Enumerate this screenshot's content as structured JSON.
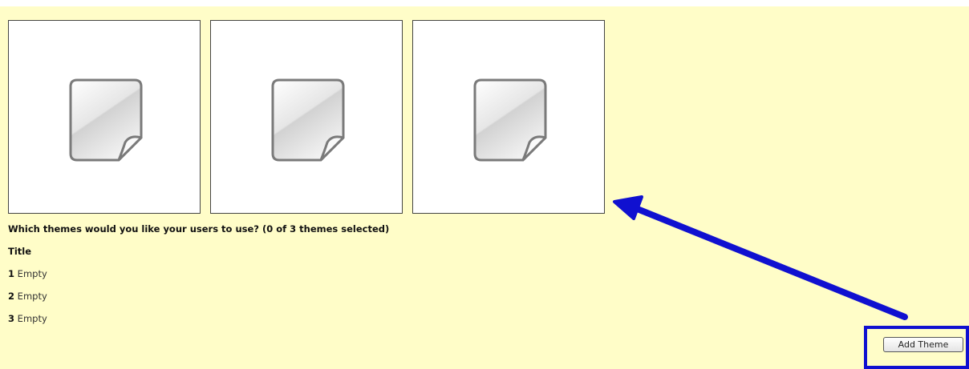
{
  "themes": {
    "thumbnails": [
      {
        "icon": "blank-document-icon"
      },
      {
        "icon": "blank-document-icon"
      },
      {
        "icon": "blank-document-icon"
      }
    ],
    "question": "Which themes would you like your users to use? (0 of 3 themes selected)",
    "title_label": "Title",
    "slots": [
      {
        "number": "1",
        "value": "Empty"
      },
      {
        "number": "2",
        "value": "Empty"
      },
      {
        "number": "3",
        "value": "Empty"
      }
    ],
    "add_button_label": "Add Theme"
  },
  "colors": {
    "panel_background": "#fffdc8",
    "annotation": "#1010d0"
  }
}
